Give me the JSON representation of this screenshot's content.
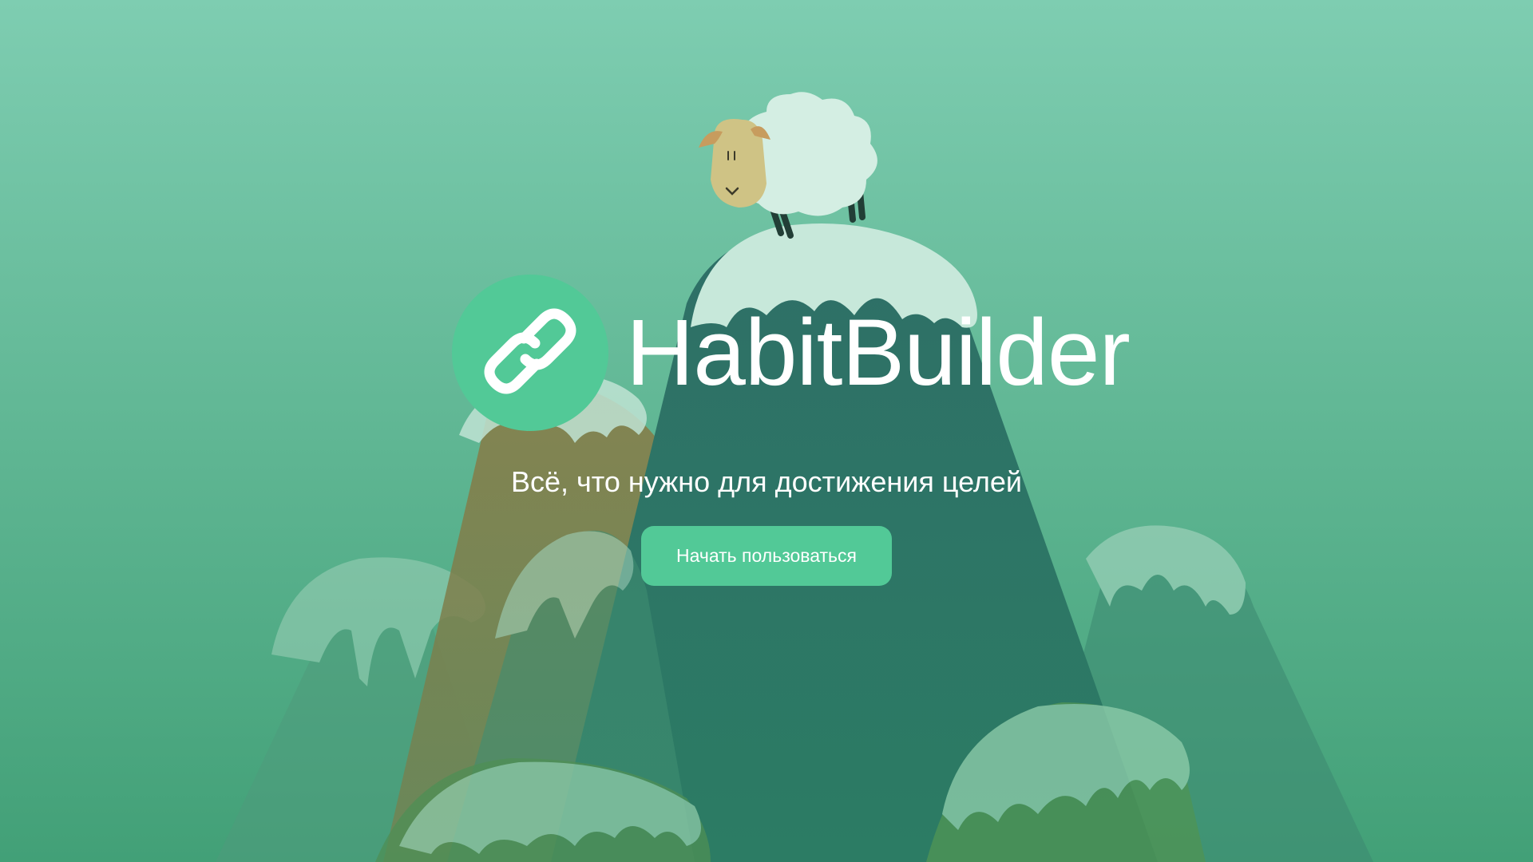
{
  "brand": {
    "name": "HabitBuilder",
    "logo_icon": "link-icon",
    "accent_color": "#52c997"
  },
  "hero": {
    "tagline": "Всё, что нужно для достижения целей",
    "cta_label": "Начать пользоваться"
  },
  "background": {
    "illustration": "mountains-with-sheep",
    "color_top": "#7dcbb0",
    "color_bottom": "#42a178"
  }
}
